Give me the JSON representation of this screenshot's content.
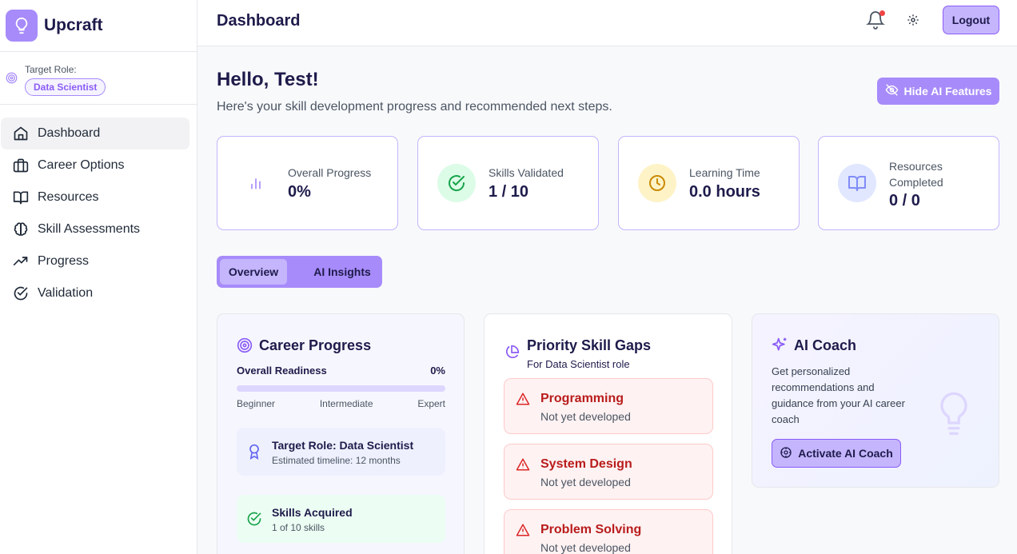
{
  "app": {
    "name": "Upcraft"
  },
  "sidebar": {
    "target_role_label": "Target Role:",
    "target_role_value": "Data Scientist",
    "items": [
      {
        "label": "Dashboard",
        "icon": "home-icon",
        "active": true
      },
      {
        "label": "Career Options",
        "icon": "briefcase-icon"
      },
      {
        "label": "Resources",
        "icon": "book-icon"
      },
      {
        "label": "Skill Assessments",
        "icon": "brain-icon"
      },
      {
        "label": "Progress",
        "icon": "trending-up-icon"
      },
      {
        "label": "Validation",
        "icon": "check-circle-icon"
      }
    ]
  },
  "header": {
    "title": "Dashboard",
    "logout_label": "Logout"
  },
  "main": {
    "greeting": "Hello, Test!",
    "subtitle": "Here's your skill development progress and recommended next steps.",
    "hide_ai_label": "Hide AI Features",
    "stats": [
      {
        "label": "Overall Progress",
        "value": "0%",
        "icon": "bar-chart-icon",
        "color": "#a78bfa"
      },
      {
        "label": "Skills Validated",
        "value": "1 / 10",
        "icon": "check-circle-icon",
        "color": "#16a34a"
      },
      {
        "label": "Learning Time",
        "value": "0.0 hours",
        "icon": "clock-icon",
        "color": "#ca8a04"
      },
      {
        "label": "Resources Completed",
        "value": "0 / 0",
        "icon": "book-open-icon",
        "color": "#818cf8"
      }
    ],
    "tabs": [
      {
        "label": "Overview",
        "active": true
      },
      {
        "label": "AI Insights"
      }
    ],
    "career_progress": {
      "title": "Career Progress",
      "readiness_label": "Overall Readiness",
      "readiness_value": "0%",
      "readiness_fraction": 0,
      "scale": [
        "Beginner",
        "Intermediate",
        "Expert"
      ],
      "target_title": "Target Role: Data Scientist",
      "target_sub": "Estimated timeline: 12 months",
      "skills_title": "Skills Acquired",
      "skills_sub": "1 of 10 skills"
    },
    "skill_gaps": {
      "title": "Priority Skill Gaps",
      "subtitle": "For Data Scientist role",
      "items": [
        {
          "name": "Programming",
          "status": "Not yet developed"
        },
        {
          "name": "System Design",
          "status": "Not yet developed"
        },
        {
          "name": "Problem Solving",
          "status": "Not yet developed"
        }
      ]
    },
    "ai_coach": {
      "title": "AI Coach",
      "description": "Get personalized recommendations and guidance from your AI career coach",
      "button_label": "Activate AI Coach"
    }
  },
  "colors": {
    "accent": "#a78bfa",
    "accent_dark": "#8b5cf6",
    "danger": "#b91c1c"
  }
}
